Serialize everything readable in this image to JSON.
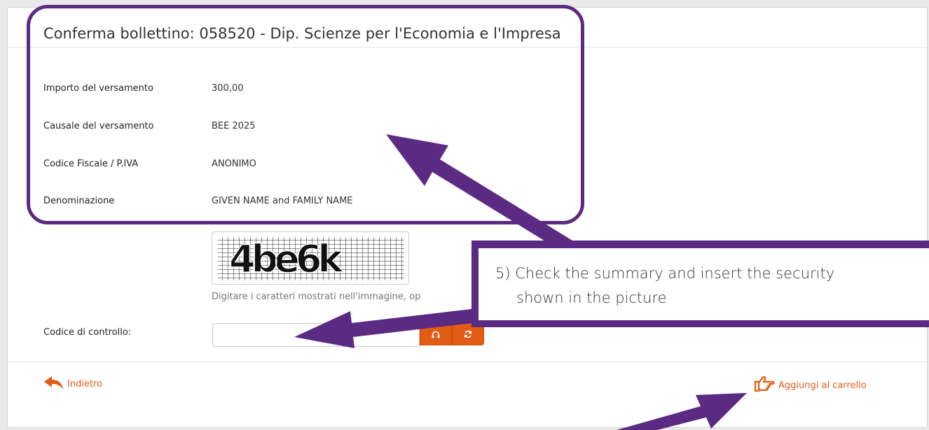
{
  "page": {
    "title": "Conferma bollettino: 058520 - Dip. Scienze per l'Economia e l'Impresa"
  },
  "summary": {
    "rows": [
      {
        "label": "Importo del versamento",
        "value": "300,00"
      },
      {
        "label": "Causale del versamento",
        "value": "BEE 2025"
      },
      {
        "label": "Codice Fiscale / P.IVA",
        "value": "ANONIMO"
      },
      {
        "label": "Denominazione",
        "value": "GIVEN NAME and FAMILY NAME"
      }
    ]
  },
  "captcha": {
    "image_text": "4be6k",
    "hint": "Digitare i caratteri mostrati nell'immagine, op",
    "code_label": "Codice di controllo:",
    "input_value": "",
    "audio_icon": "headphones-icon",
    "refresh_icon": "refresh-icon"
  },
  "actions": {
    "back_label": "Indietro",
    "back_icon": "reply-arrow-icon",
    "add_to_cart_label": "Aggiungi al carrello",
    "add_to_cart_icon": "hand-pointer-icon"
  },
  "annotation": {
    "line1": "5) Check the summary and insert the security",
    "line2": "shown in the picture"
  },
  "colors": {
    "accent": "#e35c14",
    "annotation": "#5b2a82"
  }
}
